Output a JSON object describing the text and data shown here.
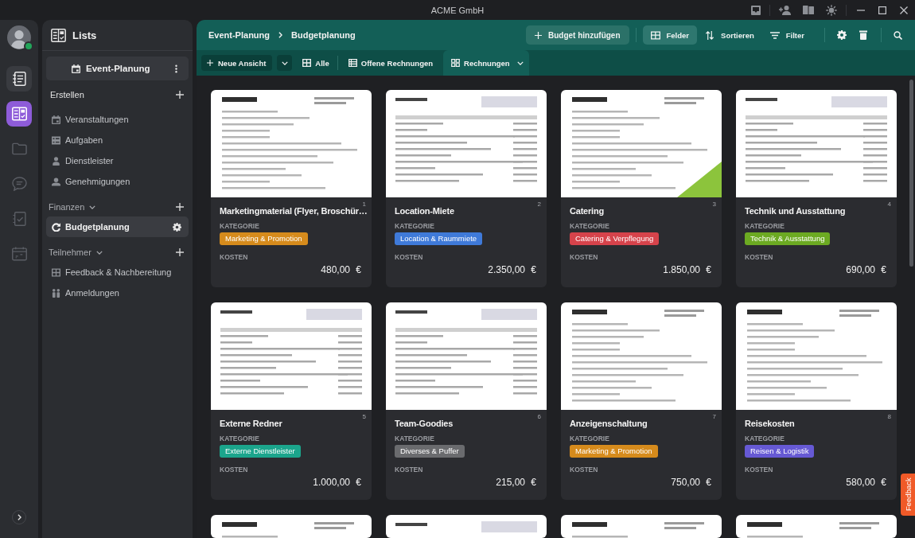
{
  "window": {
    "title": "ACME GmbH"
  },
  "account": {
    "online": true
  },
  "rail": [
    {
      "selected": false,
      "hovered": true
    },
    {
      "selected": true,
      "hovered": false
    },
    {
      "selected": false,
      "hovered": false
    },
    {
      "selected": false,
      "hovered": false
    },
    {
      "selected": false,
      "hovered": false
    },
    {
      "selected": false,
      "hovered": false
    }
  ],
  "sidebar": {
    "title": "Lists",
    "workspace": "Event-Planung",
    "create": {
      "title": "Erstellen",
      "items": [
        {
          "label": "Veranstaltungen",
          "selected": false
        },
        {
          "label": "Aufgaben",
          "selected": false
        },
        {
          "label": "Dienstleister",
          "selected": false
        },
        {
          "label": "Genehmigungen",
          "selected": false
        }
      ]
    },
    "groups": [
      {
        "title": "Finanzen",
        "expanded": true,
        "items": [
          {
            "label": "Budgetplanung",
            "selected": true
          }
        ]
      },
      {
        "title": "Teilnehmer",
        "expanded": true,
        "items": [
          {
            "label": "Feedback & Nachbereitung",
            "selected": false
          },
          {
            "label": "Anmeldungen",
            "selected": false
          }
        ]
      }
    ]
  },
  "toolbar": {
    "breadcrumb": [
      "Event-Planung",
      "Budgetplanung"
    ],
    "add_button": "Budget hinzufügen",
    "tools": [
      {
        "label": "Felder",
        "selected": true
      },
      {
        "label": "Sortieren",
        "selected": false
      },
      {
        "label": "Filter",
        "selected": false
      }
    ]
  },
  "views": {
    "new_view": "Neue Ansicht",
    "tabs": [
      {
        "label": "Alle",
        "selected": false
      },
      {
        "label": "Offene Rechnungen",
        "selected": false
      },
      {
        "label": "Rechnungen",
        "selected": true
      }
    ]
  },
  "cards": [
    {
      "number": "1",
      "title": "Marketingmaterial (Flyer, Broschür…",
      "category_label": "KATEGORIE",
      "category": {
        "label": "Marketing & Promotion",
        "color": "#d68b1c"
      },
      "cost_label": "KOSTEN",
      "cost": "480,00 €",
      "preview": {
        "kind": "letter"
      }
    },
    {
      "number": "2",
      "title": "Location-Miete",
      "category_label": "KATEGORIE",
      "category": {
        "label": "Location & Raummiete",
        "color": "#3f7ad9"
      },
      "cost_label": "KOSTEN",
      "cost": "2.350,00 €",
      "preview": {
        "kind": "table"
      }
    },
    {
      "number": "3",
      "title": "Catering",
      "category_label": "KATEGORIE",
      "category": {
        "label": "Catering & Verpflegung",
        "color": "#d6434b"
      },
      "cost_label": "KOSTEN",
      "cost": "1.850,00 €",
      "preview": {
        "kind": "accent"
      }
    },
    {
      "number": "4",
      "title": "Technik und Ausstattung",
      "category_label": "KATEGORIE",
      "category": {
        "label": "Technik & Ausstattung",
        "color": "#6caa22"
      },
      "cost_label": "KOSTEN",
      "cost": "690,00 €",
      "preview": {
        "kind": "table"
      }
    },
    {
      "number": "5",
      "title": "Externe Redner",
      "category_label": "KATEGORIE",
      "category": {
        "label": "Externe Dienstleister",
        "color": "#1ba58c"
      },
      "cost_label": "KOSTEN",
      "cost": "1.000,00 €",
      "preview": {
        "kind": "table"
      }
    },
    {
      "number": "6",
      "title": "Team-Goodies",
      "category_label": "KATEGORIE",
      "category": {
        "label": "Diverses & Puffer",
        "color": "#6a6b6e"
      },
      "cost_label": "KOSTEN",
      "cost": "215,00 €",
      "preview": {
        "kind": "table"
      }
    },
    {
      "number": "7",
      "title": "Anzeigenschaltung",
      "category_label": "KATEGORIE",
      "category": {
        "label": "Marketing & Promotion",
        "color": "#d68b1c"
      },
      "cost_label": "KOSTEN",
      "cost": "750,00 €",
      "preview": {
        "kind": "letter"
      }
    },
    {
      "number": "8",
      "title": "Reisekosten",
      "category_label": "KATEGORIE",
      "category": {
        "label": "Reisen & Logistik",
        "color": "#6659d4"
      },
      "cost_label": "KOSTEN",
      "cost": "580,00 €",
      "preview": {
        "kind": "letter"
      }
    },
    {
      "preview": {
        "kind": "letter"
      }
    },
    {
      "preview": {
        "kind": "table"
      }
    },
    {
      "preview": {
        "kind": "letter"
      }
    },
    {
      "preview": {
        "kind": "letter"
      }
    }
  ],
  "feedback_tab": {
    "label": "Feedback"
  }
}
